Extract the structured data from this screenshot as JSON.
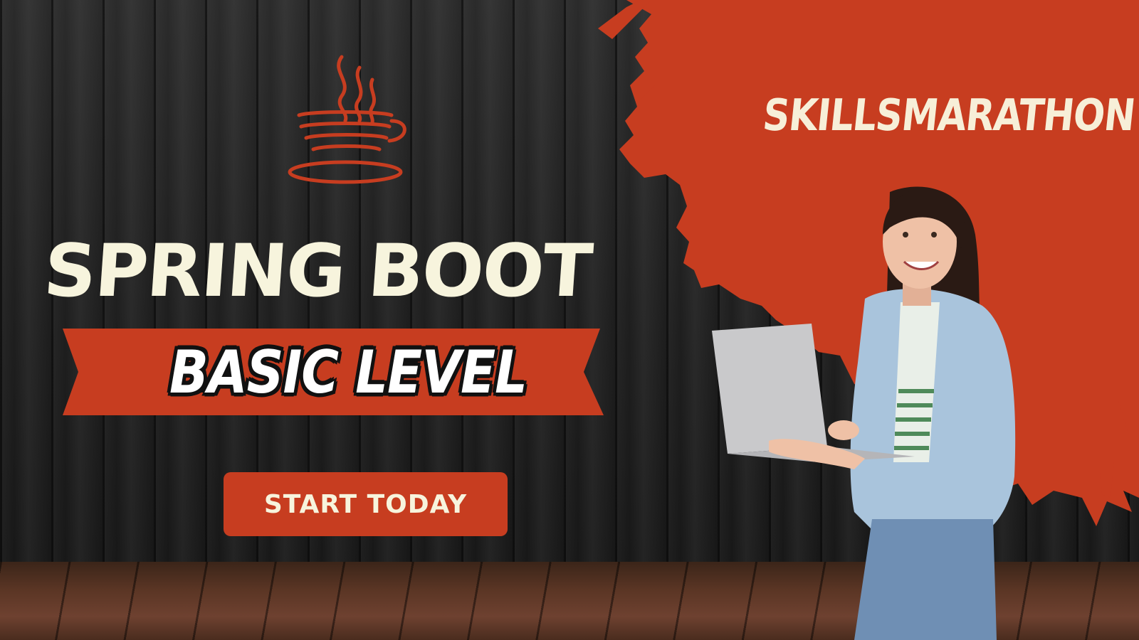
{
  "banner": {
    "title": "SPRING BOOT",
    "subtitle": "BASIC LEVEL",
    "cta_label": "START TODAY",
    "brand": "SKILLSMARATHON"
  },
  "icons": {
    "logo": "java-coffee-cup-icon"
  },
  "colors": {
    "accent": "#c73d20",
    "title_text": "#f7f4dd",
    "background": "#1f1f1f",
    "floor": "#5a3524"
  }
}
